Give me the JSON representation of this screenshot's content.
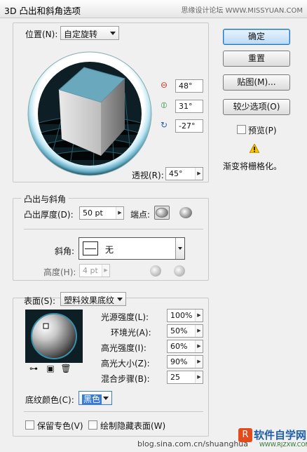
{
  "window": {
    "title": "3D 凸出和斜角选项",
    "watermark": "思缘设计论坛 WWW.MISSYUAN.COM"
  },
  "position": {
    "label": "位置(N):",
    "value": "自定旋转",
    "rot_x": "48°",
    "rot_y": "31°",
    "rot_z": "-27°",
    "perspective_label": "透视(R):",
    "perspective_value": "45°"
  },
  "buttons": {
    "ok": "确定",
    "reset": "重置",
    "map": "贴图(M)...",
    "fewer": "较少选项(O)"
  },
  "preview": {
    "label": "预览(P)",
    "checked": false
  },
  "warning": {
    "text": "渐变将栅格化。"
  },
  "extrude": {
    "group_title": "凸出与斜角",
    "depth_label": "凸出厚度(D):",
    "depth_value": "50 pt",
    "cap_label": "端点:",
    "bevel_label": "斜角:",
    "bevel_value": "无",
    "height_label": "高度(H):",
    "height_value": "4 pt"
  },
  "surface": {
    "label": "表面(S):",
    "value": "塑料效果底纹",
    "light_intensity_label": "光源强度(L):",
    "light_intensity": "100%",
    "ambient_label": "环境光(A):",
    "ambient": "50%",
    "highlight_intensity_label": "高光强度(I):",
    "highlight_intensity": "60%",
    "highlight_size_label": "高光大小(Z):",
    "highlight_size": "90%",
    "blend_steps_label": "混合步骤(B):",
    "blend_steps": "25",
    "shading_color_label": "底纹颜色(C):",
    "shading_color": "黑色",
    "preserve_spot_label": "保留专色(V)",
    "draw_hidden_label": "绘制隐藏表面(W)"
  },
  "footer": {
    "blog": "blog.sina.com.cn/shuanghua",
    "brand": "软件自学网",
    "brand_url": "WWW.RJZXW.COM"
  },
  "colors": {
    "cube_top": "#6aa8bd",
    "accent_blue": "#2b6fb6",
    "track_dark": "#0d1e24"
  }
}
